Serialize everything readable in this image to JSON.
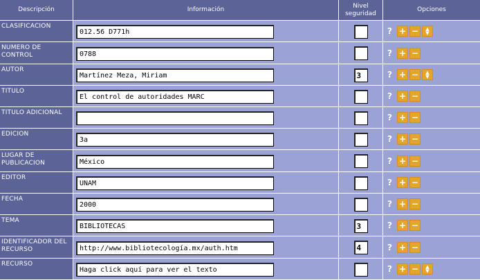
{
  "header": {
    "descripcion": "Descripción",
    "informacion": "Información",
    "nivel_line1": "Nivel",
    "nivel_line2": "seguridad",
    "opciones": "Opciones"
  },
  "icons": {
    "help": "?",
    "add": "+",
    "remove": "−",
    "move_up": "▲",
    "move_down": "▼"
  },
  "colors": {
    "header_bg": "#5b6397",
    "row_bg": "#9aa2d6",
    "button_bg": "#e3a52a"
  },
  "rows": [
    {
      "label": "CLASIFICACION",
      "value": "012.56 D771h",
      "nivel": ""
    },
    {
      "label": "NUMERO DE CONTROL",
      "value": "0788",
      "nivel": ""
    },
    {
      "label": "AUTOR",
      "value": "Martínez Meza, Miriam",
      "nivel": "3"
    },
    {
      "label": "TITULO",
      "value": "El control de autoridades MARC",
      "nivel": ""
    },
    {
      "label": "TITULO ADICIONAL",
      "value": "",
      "nivel": ""
    },
    {
      "label": "EDICION",
      "value": "3a",
      "nivel": ""
    },
    {
      "label": "LUGAR DE PUBLICACION",
      "value": "México",
      "nivel": ""
    },
    {
      "label": "EDITOR",
      "value": "UNAM",
      "nivel": ""
    },
    {
      "label": "FECHA",
      "value": "2000",
      "nivel": ""
    },
    {
      "label": "TEMA",
      "value": "BIBLIOTECAS",
      "nivel": "3"
    },
    {
      "label": "IDENTIFICADOR DEL RECURSO",
      "value": "http://www.bibliotecología.mx/auth.htm",
      "nivel": "4"
    },
    {
      "label": "RECURSO",
      "value": "Haga click aquí para ver el texto",
      "nivel": ""
    }
  ]
}
